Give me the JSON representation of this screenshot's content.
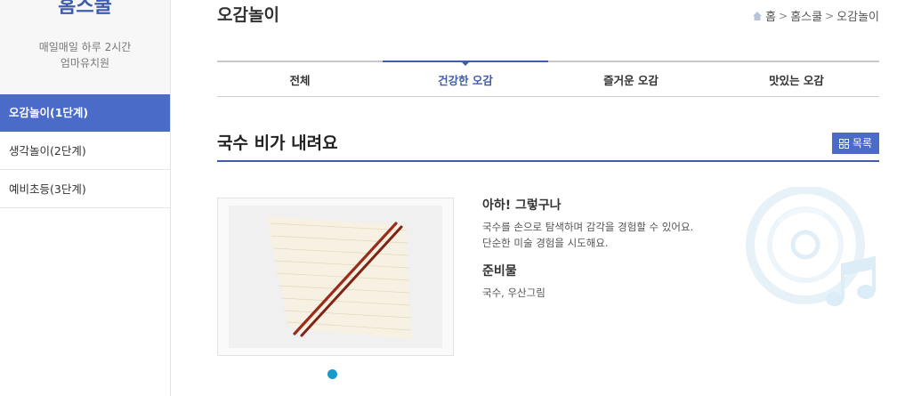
{
  "sidebar": {
    "brand": "홈스쿨",
    "tagline_line1": "매일매일 하루 2시간",
    "tagline_line2": "엄마유치원",
    "items": [
      {
        "label": "오감놀이(1단계)",
        "active": true
      },
      {
        "label": "생각놀이(2단계)",
        "active": false
      },
      {
        "label": "예비초등(3단계)",
        "active": false
      }
    ]
  },
  "header": {
    "title": "오감놀이",
    "breadcrumb": [
      "홈",
      "홈스쿨",
      "오감놀이"
    ]
  },
  "tabs": [
    {
      "label": "전체",
      "active": false
    },
    {
      "label": "건강한 오감",
      "active": true
    },
    {
      "label": "즐거운 오감",
      "active": false
    },
    {
      "label": "맛있는 오감",
      "active": false
    }
  ],
  "article": {
    "title": "국수 비가 내려요",
    "list_button": "목록",
    "section1_heading": "아하! 그렇구나",
    "section1_line1": "국수를 손으로 탐색하며 감각을 경험할 수 있어요.",
    "section1_line2": "단순한 미술 경험을 시도해요.",
    "section2_heading": "준비물",
    "section2_text": "국수, 우산그림"
  },
  "colors": {
    "accent": "#4a6bc7",
    "brand": "#3f5dab",
    "dot": "#1a9ac9"
  }
}
